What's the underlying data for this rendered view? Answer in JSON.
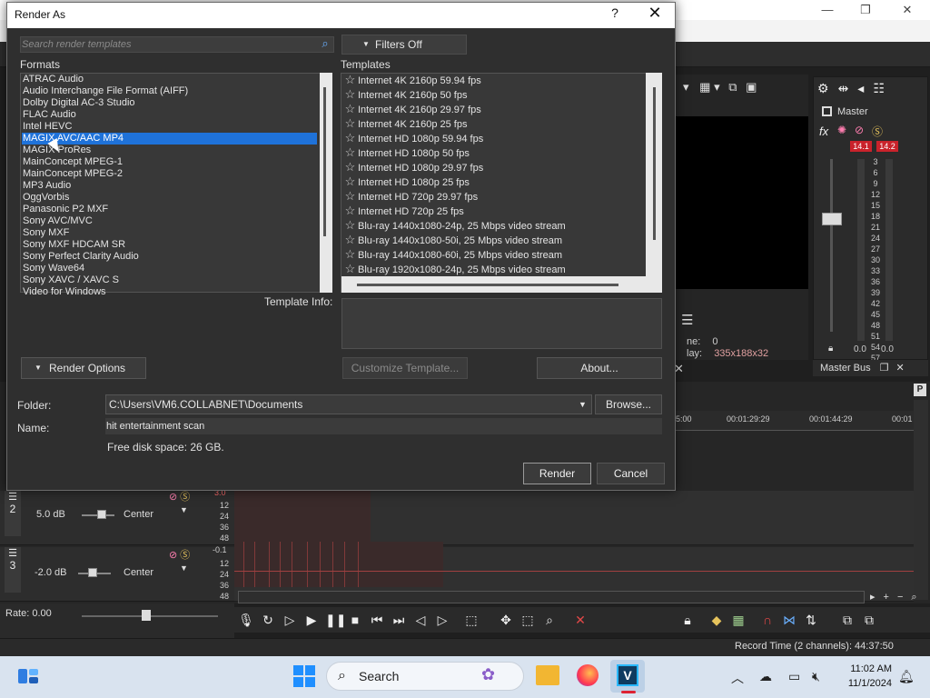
{
  "dialog": {
    "title": "Render As",
    "help_label": "?",
    "close_label": "✕",
    "search_placeholder": "Search render templates",
    "filters_label": "Filters Off",
    "formats_label": "Formats",
    "templates_label": "Templates",
    "formats": [
      "ATRAC Audio",
      "Audio Interchange File Format (AIFF)",
      "Dolby Digital AC-3 Studio",
      "FLAC Audio",
      "Intel HEVC",
      "MAGIX AVC/AAC MP4",
      "MAGIX ProRes",
      "MainConcept MPEG-1",
      "MainConcept MPEG-2",
      "MP3 Audio",
      "OggVorbis",
      "Panasonic P2 MXF",
      "Sony AVC/MVC",
      "Sony MXF",
      "Sony MXF HDCAM SR",
      "Sony Perfect Clarity Audio",
      "Sony Wave64",
      "Sony XAVC / XAVC S",
      "Video for Windows"
    ],
    "selected_format": "MAGIX AVC/AAC MP4",
    "templates": [
      "Internet 4K 2160p 59.94 fps",
      "Internet 4K 2160p 50 fps",
      "Internet 4K 2160p 29.97 fps",
      "Internet 4K 2160p 25 fps",
      "Internet HD 1080p 59.94 fps",
      "Internet HD 1080p 50 fps",
      "Internet HD 1080p 29.97 fps",
      "Internet HD 1080p 25 fps",
      "Internet HD 720p 29.97 fps",
      "Internet HD 720p 25 fps",
      "Blu-ray 1440x1080-24p, 25 Mbps video stream",
      "Blu-ray 1440x1080-50i, 25 Mbps video stream",
      "Blu-ray 1440x1080-60i, 25 Mbps video stream",
      "Blu-ray 1920x1080-24p, 25 Mbps video stream"
    ],
    "template_info_label": "Template Info:",
    "render_options_label": "Render Options",
    "customize_label": "Customize Template...",
    "about_label": "About...",
    "folder_label": "Folder:",
    "folder_value": "C:\\Users\\VM6.COLLABNET\\Documents",
    "browse_label": "Browse...",
    "name_label": "Name:",
    "name_value": "hit entertainment scan",
    "free_disk": "Free disk space: 26 GB.",
    "render_label": "Render",
    "cancel_label": "Cancel"
  },
  "preview": {
    "frame_label": "ne:",
    "frame_value": "0",
    "display_label": "lay:",
    "display_value": "335x188x32"
  },
  "master_bus": {
    "label": "Master",
    "fx_label": "fx",
    "peak_left": "14.1",
    "peak_right": "14.2",
    "scale": [
      "3",
      "6",
      "9",
      "12",
      "15",
      "18",
      "21",
      "24",
      "27",
      "30",
      "33",
      "36",
      "39",
      "42",
      "45",
      "48",
      "51",
      "54",
      "57"
    ],
    "zero_left": "0.0",
    "zero_right": "0.0",
    "tab_label": "Master Bus"
  },
  "timeline": {
    "ruler_ticks": [
      "5:00",
      "00:01:29:29",
      "00:01:44:29",
      "00:01"
    ],
    "tracks": [
      {
        "number": "2",
        "volume": "5.0 dB",
        "pan": "Center",
        "peak": "3.0",
        "meter": [
          "12",
          "24",
          "36",
          "48"
        ]
      },
      {
        "number": "3",
        "volume": "-2.0 dB",
        "pan": "Center",
        "peak": "-0.1",
        "meter": [
          "12",
          "24",
          "36",
          "48"
        ]
      }
    ],
    "rate_label": "Rate: 0.00",
    "record_time": "Record Time (2 channels): 44:37:50"
  },
  "taskbar": {
    "search_label": "Search",
    "time": "11:02 AM",
    "date": "11/1/2024",
    "vegas_label": "V"
  }
}
